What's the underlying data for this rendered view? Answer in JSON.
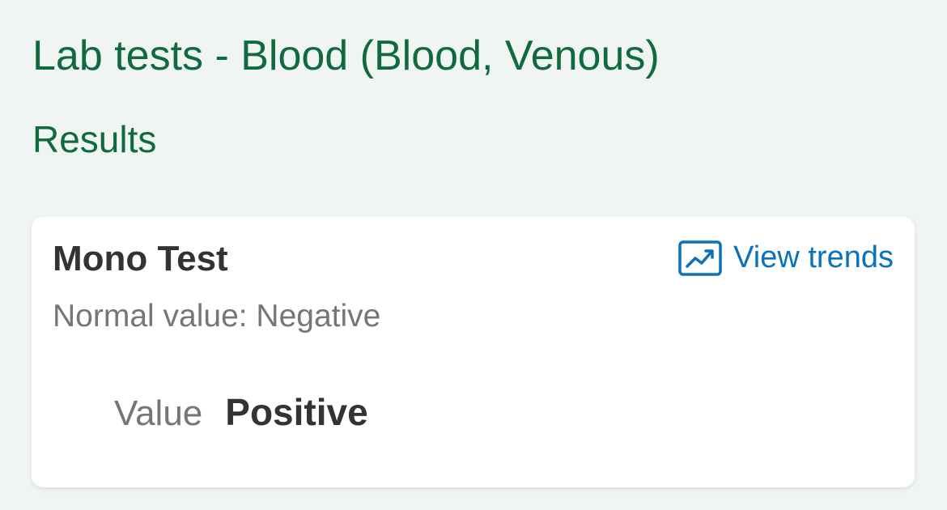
{
  "header": {
    "title": "Lab tests - Blood (Blood, Venous)",
    "section": "Results"
  },
  "result_card": {
    "test_name": "Mono Test",
    "normal_value": "Normal value: Negative",
    "trends_link": {
      "label": "View trends",
      "icon": "trend-chart-icon"
    },
    "value_label": "Value",
    "value": "Positive"
  },
  "colors": {
    "heading": "#0f6a3f",
    "link": "#0a72b8",
    "background": "#f0f5f4"
  }
}
